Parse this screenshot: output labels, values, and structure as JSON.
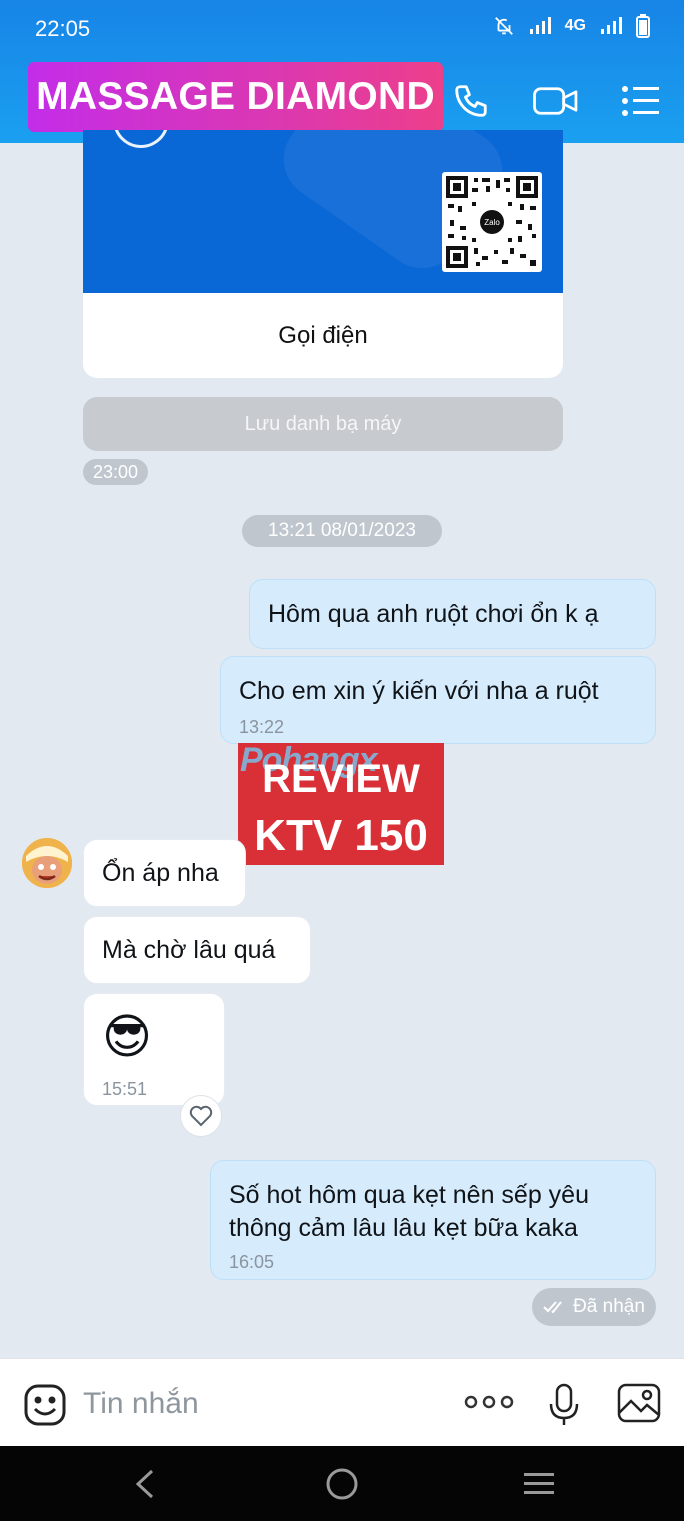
{
  "status_bar": {
    "time": "22:05",
    "network": "4G"
  },
  "header": {
    "title": "MASSAGE DIAMOND"
  },
  "contact_card": {
    "qr_label": "Zalo",
    "call_label": "Gọi điện",
    "save_label": "Lưu danh bạ máy",
    "time": "23:00"
  },
  "date_separator": "13:21 08/01/2023",
  "messages": [
    {
      "text": "Hôm qua anh ruột chơi ổn k ạ"
    },
    {
      "text": "Cho em xin ý kiến với nha a ruột",
      "time": "13:22"
    },
    {
      "text": "Ổn áp nha"
    },
    {
      "text": "Mà chờ lâu quá"
    },
    {
      "emoji": "😎",
      "time": "15:51"
    },
    {
      "line1": "Số hot hôm qua kẹt nên sếp yêu",
      "line2": "thông cảm lâu lâu kẹt bữa kaka",
      "time": "16:05"
    }
  ],
  "overlay": {
    "watermark": "Pohangx",
    "line1": "REVIEW",
    "line2": "KTV 150"
  },
  "status": {
    "received": "Đã nhận"
  },
  "composer": {
    "placeholder": "Tin nhắn"
  },
  "colors": {
    "header_blue": "#1784e6",
    "title_gradient_start": "#c32de8",
    "title_gradient_end": "#ec3f8b",
    "my_bubble": "#d6ecfd",
    "card_blue": "#0a68d6"
  }
}
